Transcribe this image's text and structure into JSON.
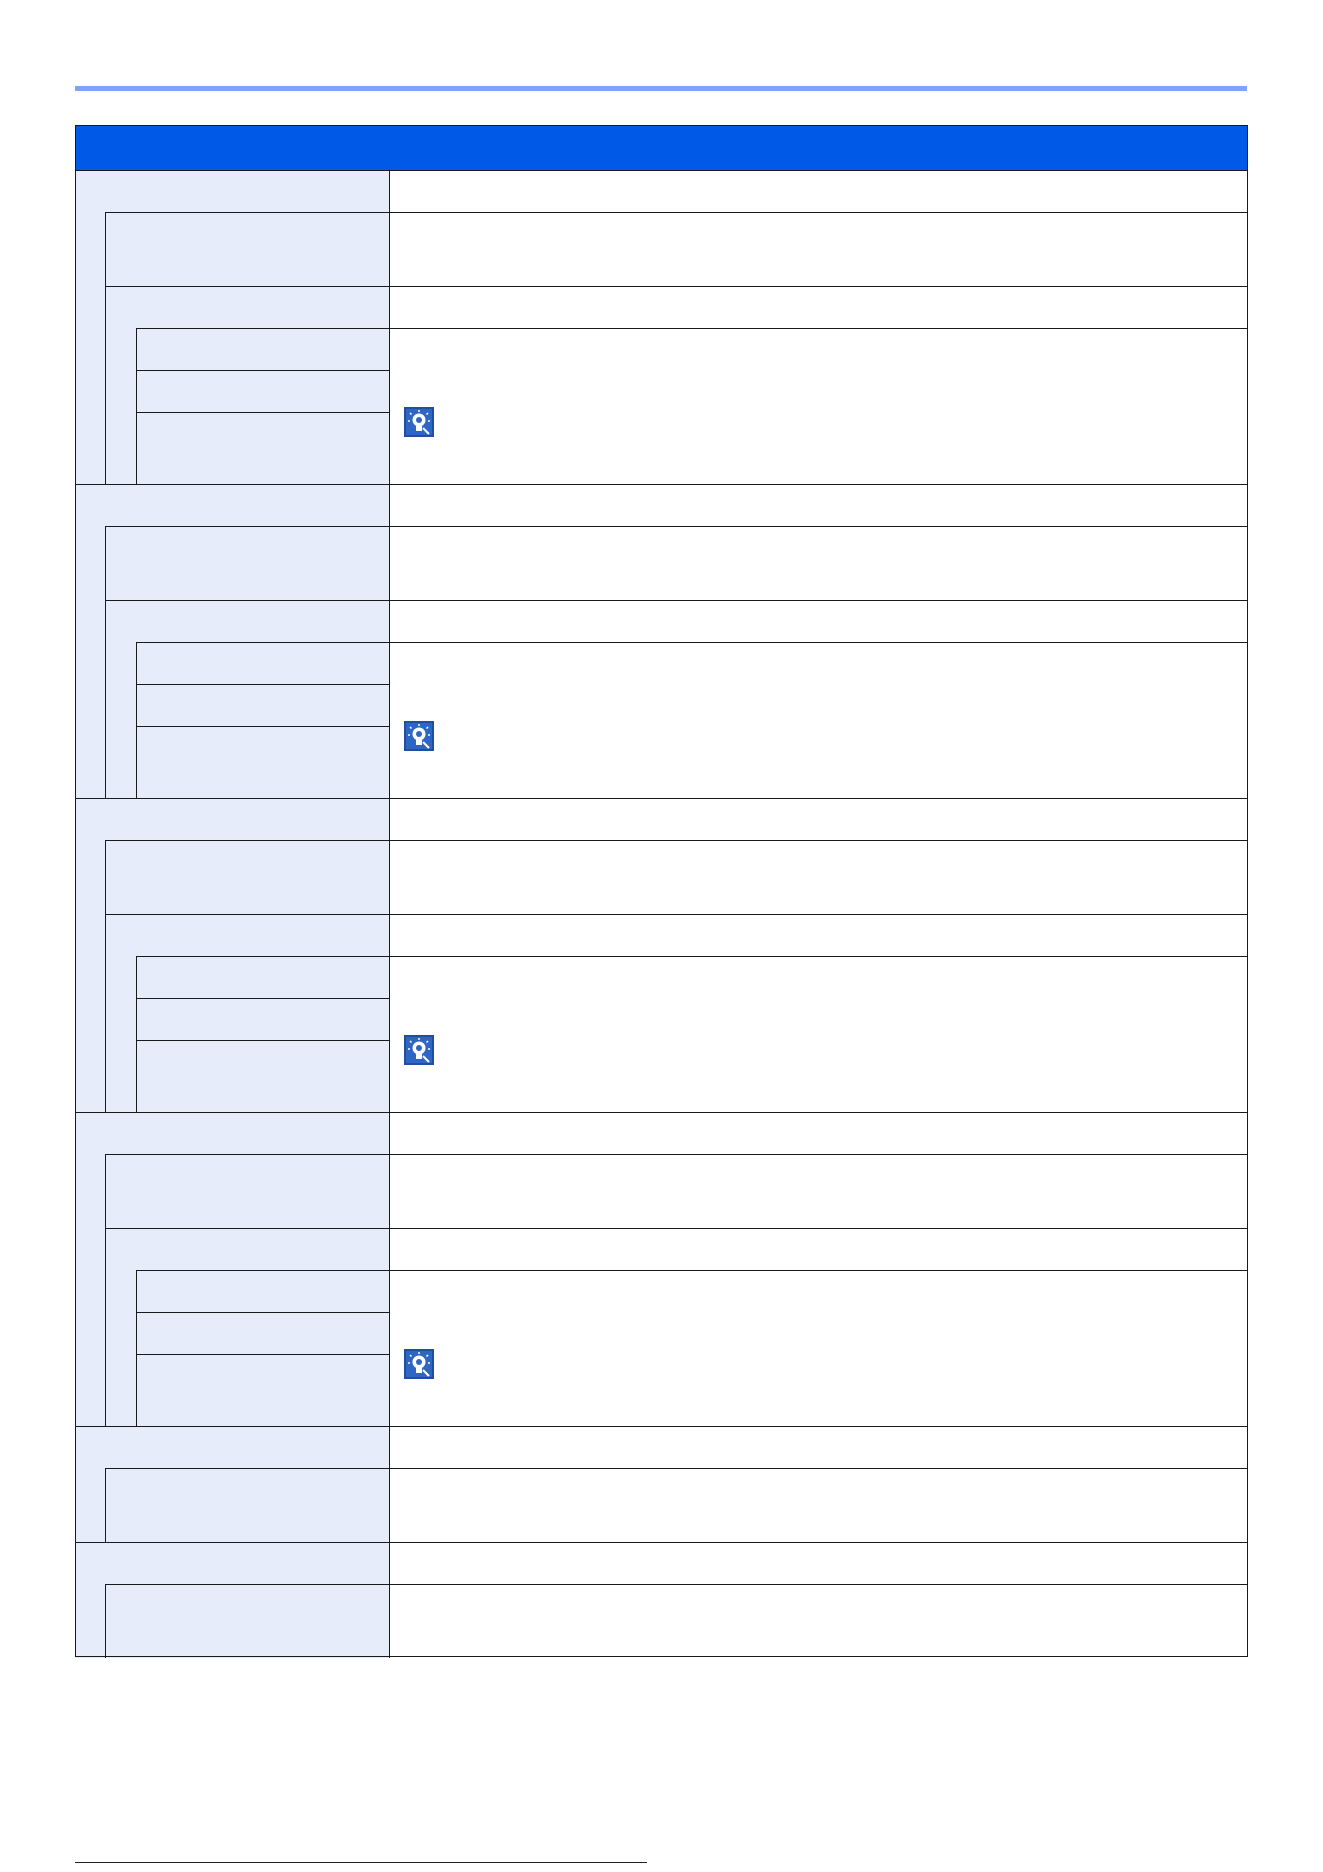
{
  "table": {
    "headers": [
      "",
      ""
    ],
    "groups": [
      {
        "label": "",
        "description": "",
        "rows": [
          {
            "label": "",
            "description": ""
          },
          {
            "label": "",
            "description": "",
            "options": [
              {
                "label": ""
              },
              {
                "label": ""
              },
              {
                "label": ""
              }
            ],
            "options_description": "",
            "has_hint_icon": true
          }
        ]
      },
      {
        "label": "",
        "description": "",
        "rows": [
          {
            "label": "",
            "description": ""
          },
          {
            "label": "",
            "description": "",
            "options": [
              {
                "label": ""
              },
              {
                "label": ""
              },
              {
                "label": ""
              }
            ],
            "options_description": "",
            "has_hint_icon": true
          }
        ]
      },
      {
        "label": "",
        "description": "",
        "rows": [
          {
            "label": "",
            "description": ""
          },
          {
            "label": "",
            "description": "",
            "options": [
              {
                "label": ""
              },
              {
                "label": ""
              },
              {
                "label": ""
              }
            ],
            "options_description": "",
            "has_hint_icon": true
          }
        ]
      },
      {
        "label": "",
        "description": "",
        "rows": [
          {
            "label": "",
            "description": ""
          },
          {
            "label": "",
            "description": "",
            "options": [
              {
                "label": ""
              },
              {
                "label": ""
              },
              {
                "label": ""
              }
            ],
            "options_description": "",
            "has_hint_icon": true
          }
        ]
      },
      {
        "label": "",
        "description": "",
        "rows": [
          {
            "label": "",
            "description": ""
          }
        ]
      },
      {
        "label": "",
        "description": "",
        "rows": [
          {
            "label": "",
            "description": ""
          }
        ]
      }
    ]
  },
  "footer": {
    "page_text": ""
  },
  "icons": {
    "hint": "lightbulb-hint-icon"
  },
  "colors": {
    "header": "#005ae8",
    "name_cell": "#e6ecf9",
    "rule": "#7aa6f5"
  }
}
